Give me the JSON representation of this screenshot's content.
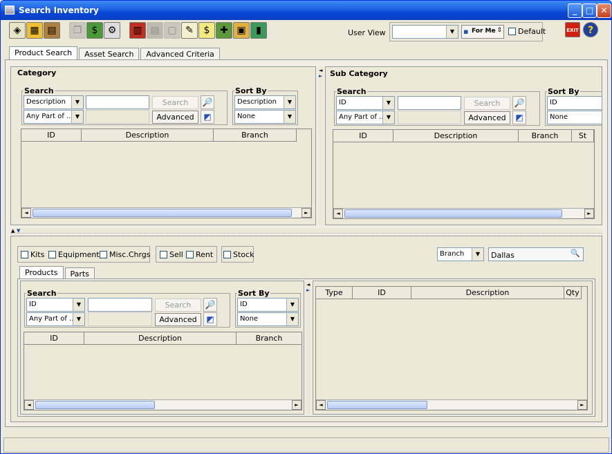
{
  "window": {
    "title": "Search Inventory"
  },
  "toolbar": {
    "user_view_label": "User View",
    "user_view_value": "",
    "for_me_label": "For Me",
    "default_label": "Default"
  },
  "tabs": [
    {
      "label": "Product Search"
    },
    {
      "label": "Asset Search"
    },
    {
      "label": "Advanced Criteria"
    }
  ],
  "category": {
    "title": "Category",
    "search_title": "Search",
    "field": "Description",
    "match": "Any Part of ...",
    "search_btn": "Search",
    "advanced_btn": "Advanced",
    "sort_title": "Sort By",
    "sort1": "Description",
    "sort2": "None",
    "columns": [
      "ID",
      "Description",
      "Branch"
    ]
  },
  "subcategory": {
    "title": "Sub Category",
    "search_title": "Search",
    "field": "ID",
    "match": "Any Part of ...",
    "search_btn": "Search",
    "advanced_btn": "Advanced",
    "sort_title": "Sort By",
    "sort1": "ID",
    "sort2": "None",
    "columns": [
      "ID",
      "Description",
      "Branch",
      "St"
    ]
  },
  "filters": {
    "kits": "Kits",
    "equipment": "Equipment",
    "misc": "Misc.Chrgs",
    "sell": "Sell",
    "rent": "Rent",
    "stock": "Stock",
    "branch_select": "Branch",
    "branch_value": "Dallas"
  },
  "subtabs": [
    {
      "label": "Products"
    },
    {
      "label": "Parts"
    }
  ],
  "products": {
    "search_title": "Search",
    "field": "ID",
    "match": "Any Part of ...",
    "search_btn": "Search",
    "advanced_btn": "Advanced",
    "sort_title": "Sort By",
    "sort1": "ID",
    "sort2": "None",
    "columns": [
      "ID",
      "Description",
      "Branch"
    ]
  },
  "results": {
    "columns": [
      "Type",
      "ID",
      "Description",
      "Qty"
    ]
  }
}
